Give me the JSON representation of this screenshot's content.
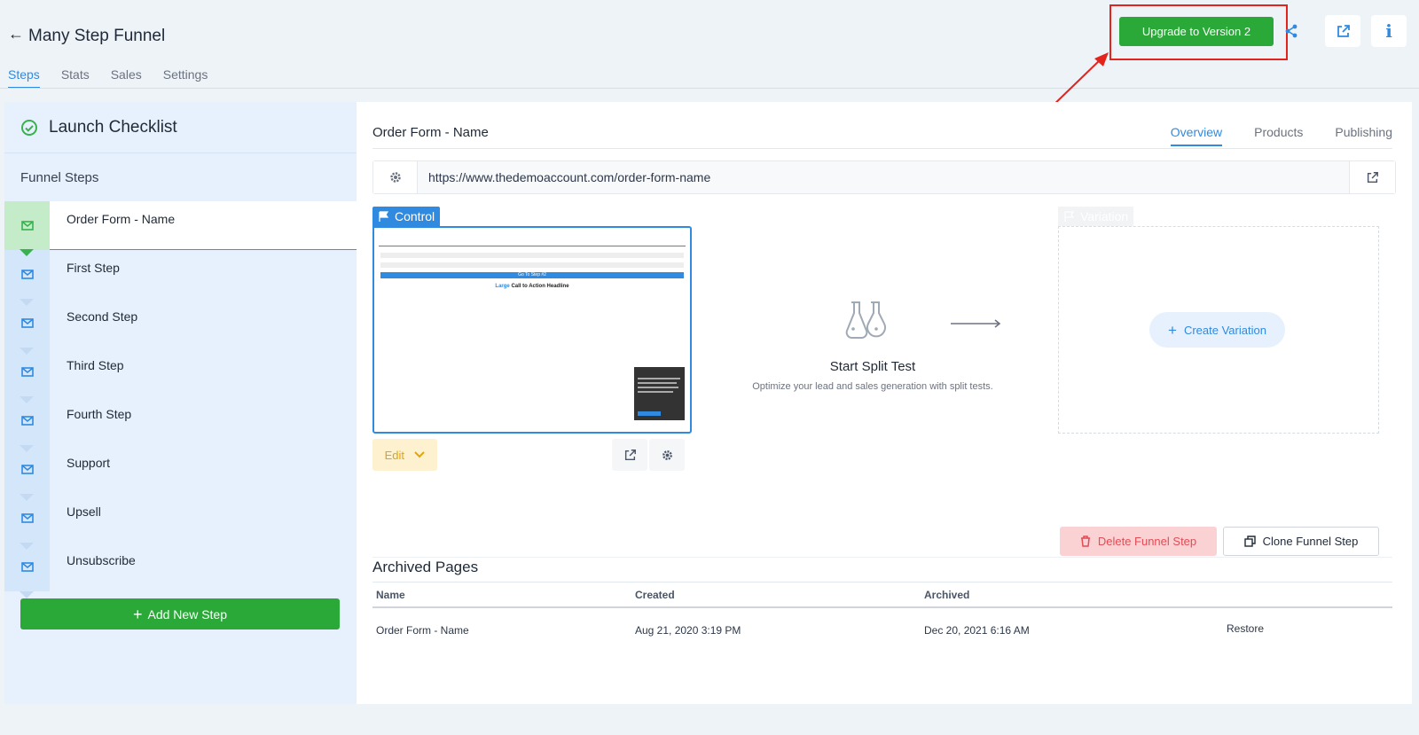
{
  "header": {
    "title": "Many Step Funnel",
    "tabs": [
      {
        "label": "Steps",
        "active": true
      },
      {
        "label": "Stats",
        "active": false
      },
      {
        "label": "Sales",
        "active": false
      },
      {
        "label": "Settings",
        "active": false
      }
    ],
    "upgrade_label": "Upgrade to Version 2",
    "icons": [
      "share-icon",
      "external-link-icon",
      "info-icon"
    ]
  },
  "sidebar": {
    "checklist_title": "Launch Checklist",
    "funnel_steps_label": "Funnel Steps",
    "steps": [
      {
        "label": "Order Form - Name",
        "active": true
      },
      {
        "label": "First Step"
      },
      {
        "label": "Second Step"
      },
      {
        "label": "Third Step"
      },
      {
        "label": "Fourth Step"
      },
      {
        "label": "Support"
      },
      {
        "label": "Upsell"
      },
      {
        "label": "Unsubscribe"
      }
    ],
    "add_step_label": "Add New Step"
  },
  "main": {
    "page_name": "Order Form - Name",
    "subtabs": [
      {
        "label": "Overview",
        "active": true
      },
      {
        "label": "Products"
      },
      {
        "label": "Publishing"
      }
    ],
    "url": "https://www.thedemoaccount.com/order-form-name",
    "control_label": "Control",
    "edit_label": "Edit",
    "preview": {
      "cta_text": "Go To Step #2",
      "headline_prefix": "Large",
      "headline_rest": "Call to Action Headline"
    },
    "split_test": {
      "title": "Start Split Test",
      "description": "Optimize your lead and sales generation with split tests."
    },
    "variation_label": "Variation",
    "create_variation_label": "Create Variation",
    "delete_label": "Delete Funnel Step",
    "clone_label": "Clone Funnel Step",
    "archived": {
      "title": "Archived Pages",
      "columns": [
        "Name",
        "Created",
        "Archived"
      ],
      "rows": [
        {
          "name": "Order Form - Name",
          "created": "Aug 21, 2020 3:19 PM",
          "archived": "Dec 20, 2021 6:16 AM",
          "action": "Restore"
        }
      ]
    }
  },
  "colors": {
    "accent": "#2f8ae0",
    "green": "#2aa838",
    "annotation_red": "#e3231c",
    "edit_yellow": "#e3a409",
    "danger": "#e34b55"
  }
}
